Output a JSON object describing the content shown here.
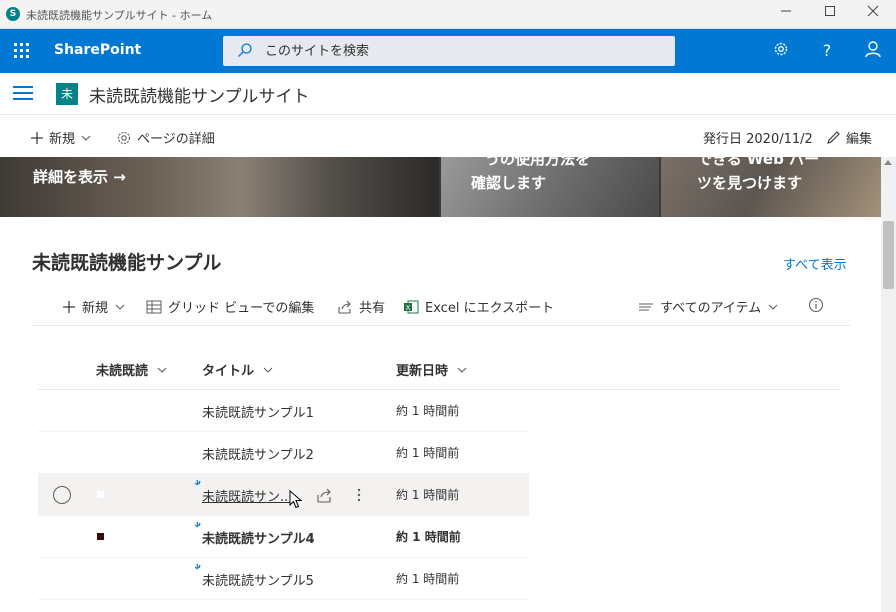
{
  "window": {
    "app_icon": "S",
    "title": "未読既読機能サンプルサイト - ホーム",
    "icons": [
      "sharepoint-app-icon",
      "minimize-icon",
      "maximize-icon",
      "close-icon"
    ]
  },
  "suitebar": {
    "brand": "SharePoint",
    "search_placeholder": "このサイトを検索",
    "accent_color": "#0078d4",
    "icons": [
      "waffle-icon",
      "search-icon",
      "settings-gear-icon",
      "help-icon",
      "user-profile-icon"
    ]
  },
  "site": {
    "logo_letter": "未",
    "title": "未読既読機能サンプルサイト",
    "logo_color": "#038387"
  },
  "commandbar": {
    "new_label": "新規",
    "page_details_label": "ページの詳細",
    "published": "発行日 2020/11/2",
    "edit_label": "編集"
  },
  "hero": {
    "tiles": [
      {
        "text": "詳細を表示 →"
      },
      {
        "text_line1": "うの使用方法を",
        "text_line2": "確認します"
      },
      {
        "text_line1": "できる Web パー",
        "text_line2": "ツを見つけます"
      }
    ]
  },
  "list": {
    "title": "未読既読機能サンプル",
    "see_all": "すべて表示",
    "commands": {
      "new": "新規",
      "grid_edit": "グリッド ビューでの編集",
      "share": "共有",
      "excel_export": "Excel にエクスポート",
      "view": "すべてのアイテム"
    },
    "columns": [
      "未読既読",
      "タイトル",
      "更新日時"
    ],
    "rows": [
      {
        "title": "未読既読サンプル1",
        "modified": "約 1 時間前",
        "unread": false,
        "new": false,
        "hover": false
      },
      {
        "title": "未読既読サンプル2",
        "modified": "約 1 時間前",
        "unread": false,
        "new": false,
        "hover": false
      },
      {
        "title": "未読既読サン...",
        "modified": "約 1 時間前",
        "unread": false,
        "new": true,
        "hover": true
      },
      {
        "title": "未読既読サンプル4",
        "modified": "約 1 時間前",
        "unread": true,
        "new": true,
        "hover": false
      },
      {
        "title": "未読既読サンプル5",
        "modified": "約 1 時間前",
        "unread": false,
        "new": true,
        "hover": false
      }
    ],
    "unread_mark_color": "#3b0a0a"
  }
}
